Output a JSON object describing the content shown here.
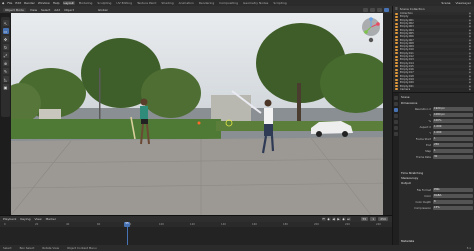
{
  "top_menu": [
    "File",
    "Edit",
    "Render",
    "Window",
    "Help"
  ],
  "workspaces": [
    "Layout",
    "Modeling",
    "Sculpting",
    "UV Editing",
    "Texture Paint",
    "Shading",
    "Animation",
    "Rendering",
    "Compositing",
    "Geometry Nodes",
    "Scripting"
  ],
  "active_workspace": "Layout",
  "scene_name": "Scene",
  "view_layer": "ViewLayer",
  "viewport_header": {
    "mode": "Object Mode",
    "menus": [
      "View",
      "Select",
      "Add",
      "Object"
    ],
    "orientation": "Global"
  },
  "toolbar_icons": [
    "cursor-icon",
    "move-icon",
    "rotate-icon",
    "scale-icon",
    "transform-icon",
    "annotate-icon",
    "measure-icon",
    "add-cube-icon"
  ],
  "outliner": {
    "title": "Scene Collection",
    "rows": [
      "Collection",
      "Empty",
      "Empty.001",
      "Empty.002",
      "Empty.003",
      "Empty.004",
      "Empty.005",
      "Empty.006",
      "Empty.007",
      "Empty.008",
      "Empty.009",
      "Empty.010",
      "Empty.011",
      "Empty.012",
      "Empty.013",
      "Empty.014",
      "Empty.015",
      "Empty.016",
      "Empty.017",
      "Empty.018",
      "Empty.019",
      "Empty.020",
      "Empty.021",
      "Camera"
    ]
  },
  "properties": {
    "sections": [
      {
        "title": "Scene"
      },
      {
        "title": "Dimensions"
      }
    ],
    "fields": [
      {
        "label": "Resolution X",
        "value": "1920 px"
      },
      {
        "label": "Y",
        "value": "1080 px"
      },
      {
        "label": "%",
        "value": "100%"
      },
      {
        "label": "Aspect X",
        "value": "1.000"
      },
      {
        "label": "Y",
        "value": "1.000"
      },
      {
        "label": "Frame Start",
        "value": "1"
      },
      {
        "label": "End",
        "value": "250"
      },
      {
        "label": "Step",
        "value": "1"
      },
      {
        "label": "Frame Rate",
        "value": "30"
      }
    ],
    "lower_sections": [
      "Time Stretching",
      "Stereoscopy",
      "Output"
    ],
    "output_fields": [
      {
        "label": "File Format",
        "value": "PNG"
      },
      {
        "label": "Color",
        "value": "RGBA"
      },
      {
        "label": "Color Depth",
        "value": "8"
      },
      {
        "label": "Compression",
        "value": "15%"
      }
    ],
    "bottom_sections": [
      "Metadata",
      "Post Processing"
    ]
  },
  "timeline": {
    "menus": [
      "Playback",
      "Keying",
      "View",
      "Marker"
    ],
    "current_frame": "55",
    "start": "1",
    "end": "250",
    "ruler": [
      "0",
      "20",
      "40",
      "60",
      "80",
      "100",
      "120",
      "140",
      "160",
      "180",
      "200",
      "220",
      "240"
    ]
  },
  "statusbar": {
    "items": [
      "Select",
      "Box Select",
      "Rotate View",
      "Object Context Menu"
    ],
    "version": "3.x"
  }
}
